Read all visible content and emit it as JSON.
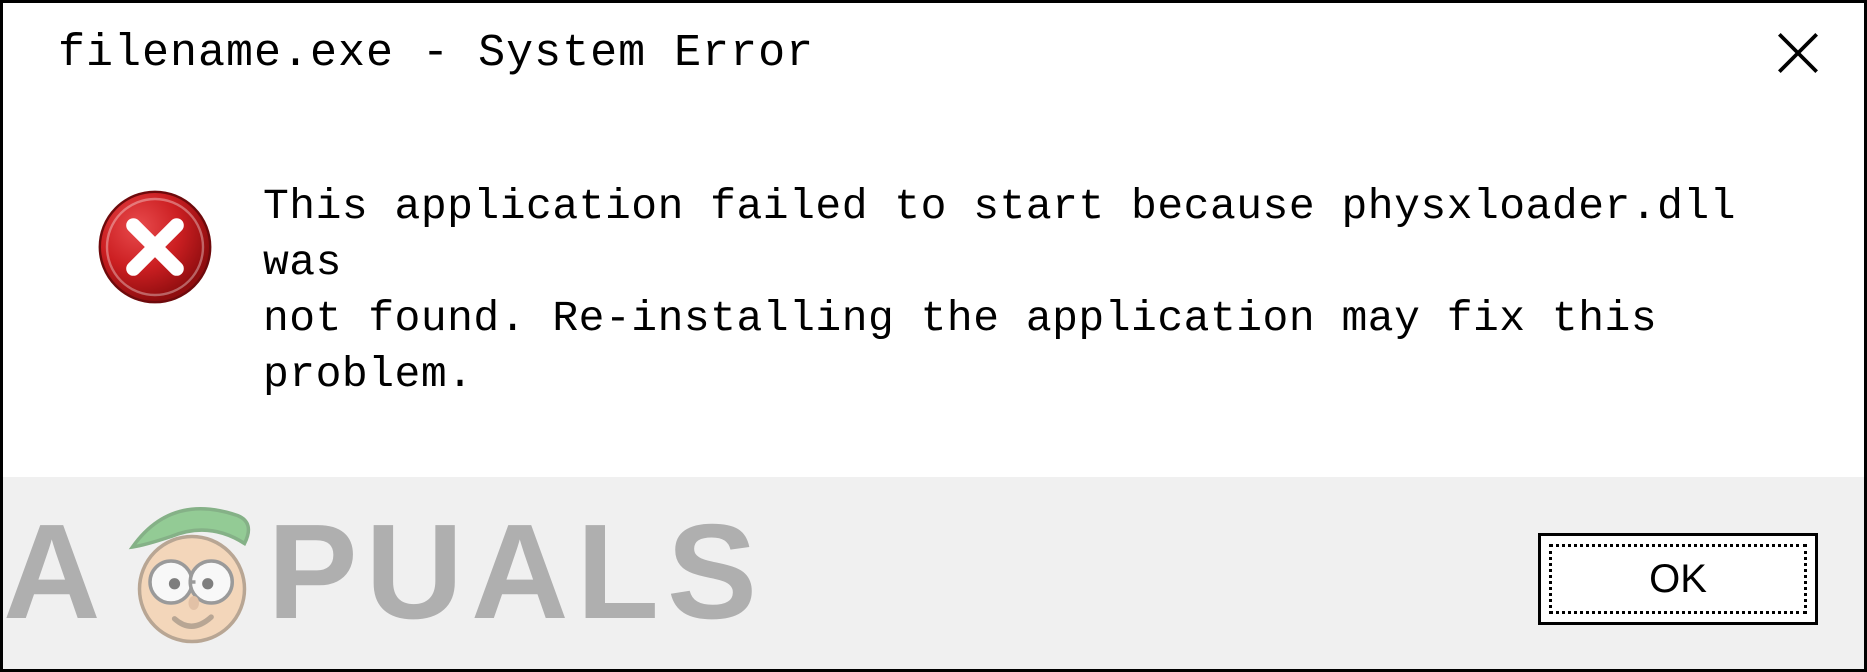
{
  "dialog": {
    "title": "filename.exe - System Error",
    "message": "This application failed to start because physxloader.dll was\nnot found. Re-installing the application may fix this problem.",
    "ok_label": "OK"
  },
  "watermark": {
    "brand_prefix": "A",
    "brand_suffix": "PUALS"
  },
  "colors": {
    "error_red": "#b8181a",
    "mascot_green": "#48ae4c",
    "mascot_skin": "#f7c18e",
    "button_bg": "#f0f0f0"
  }
}
